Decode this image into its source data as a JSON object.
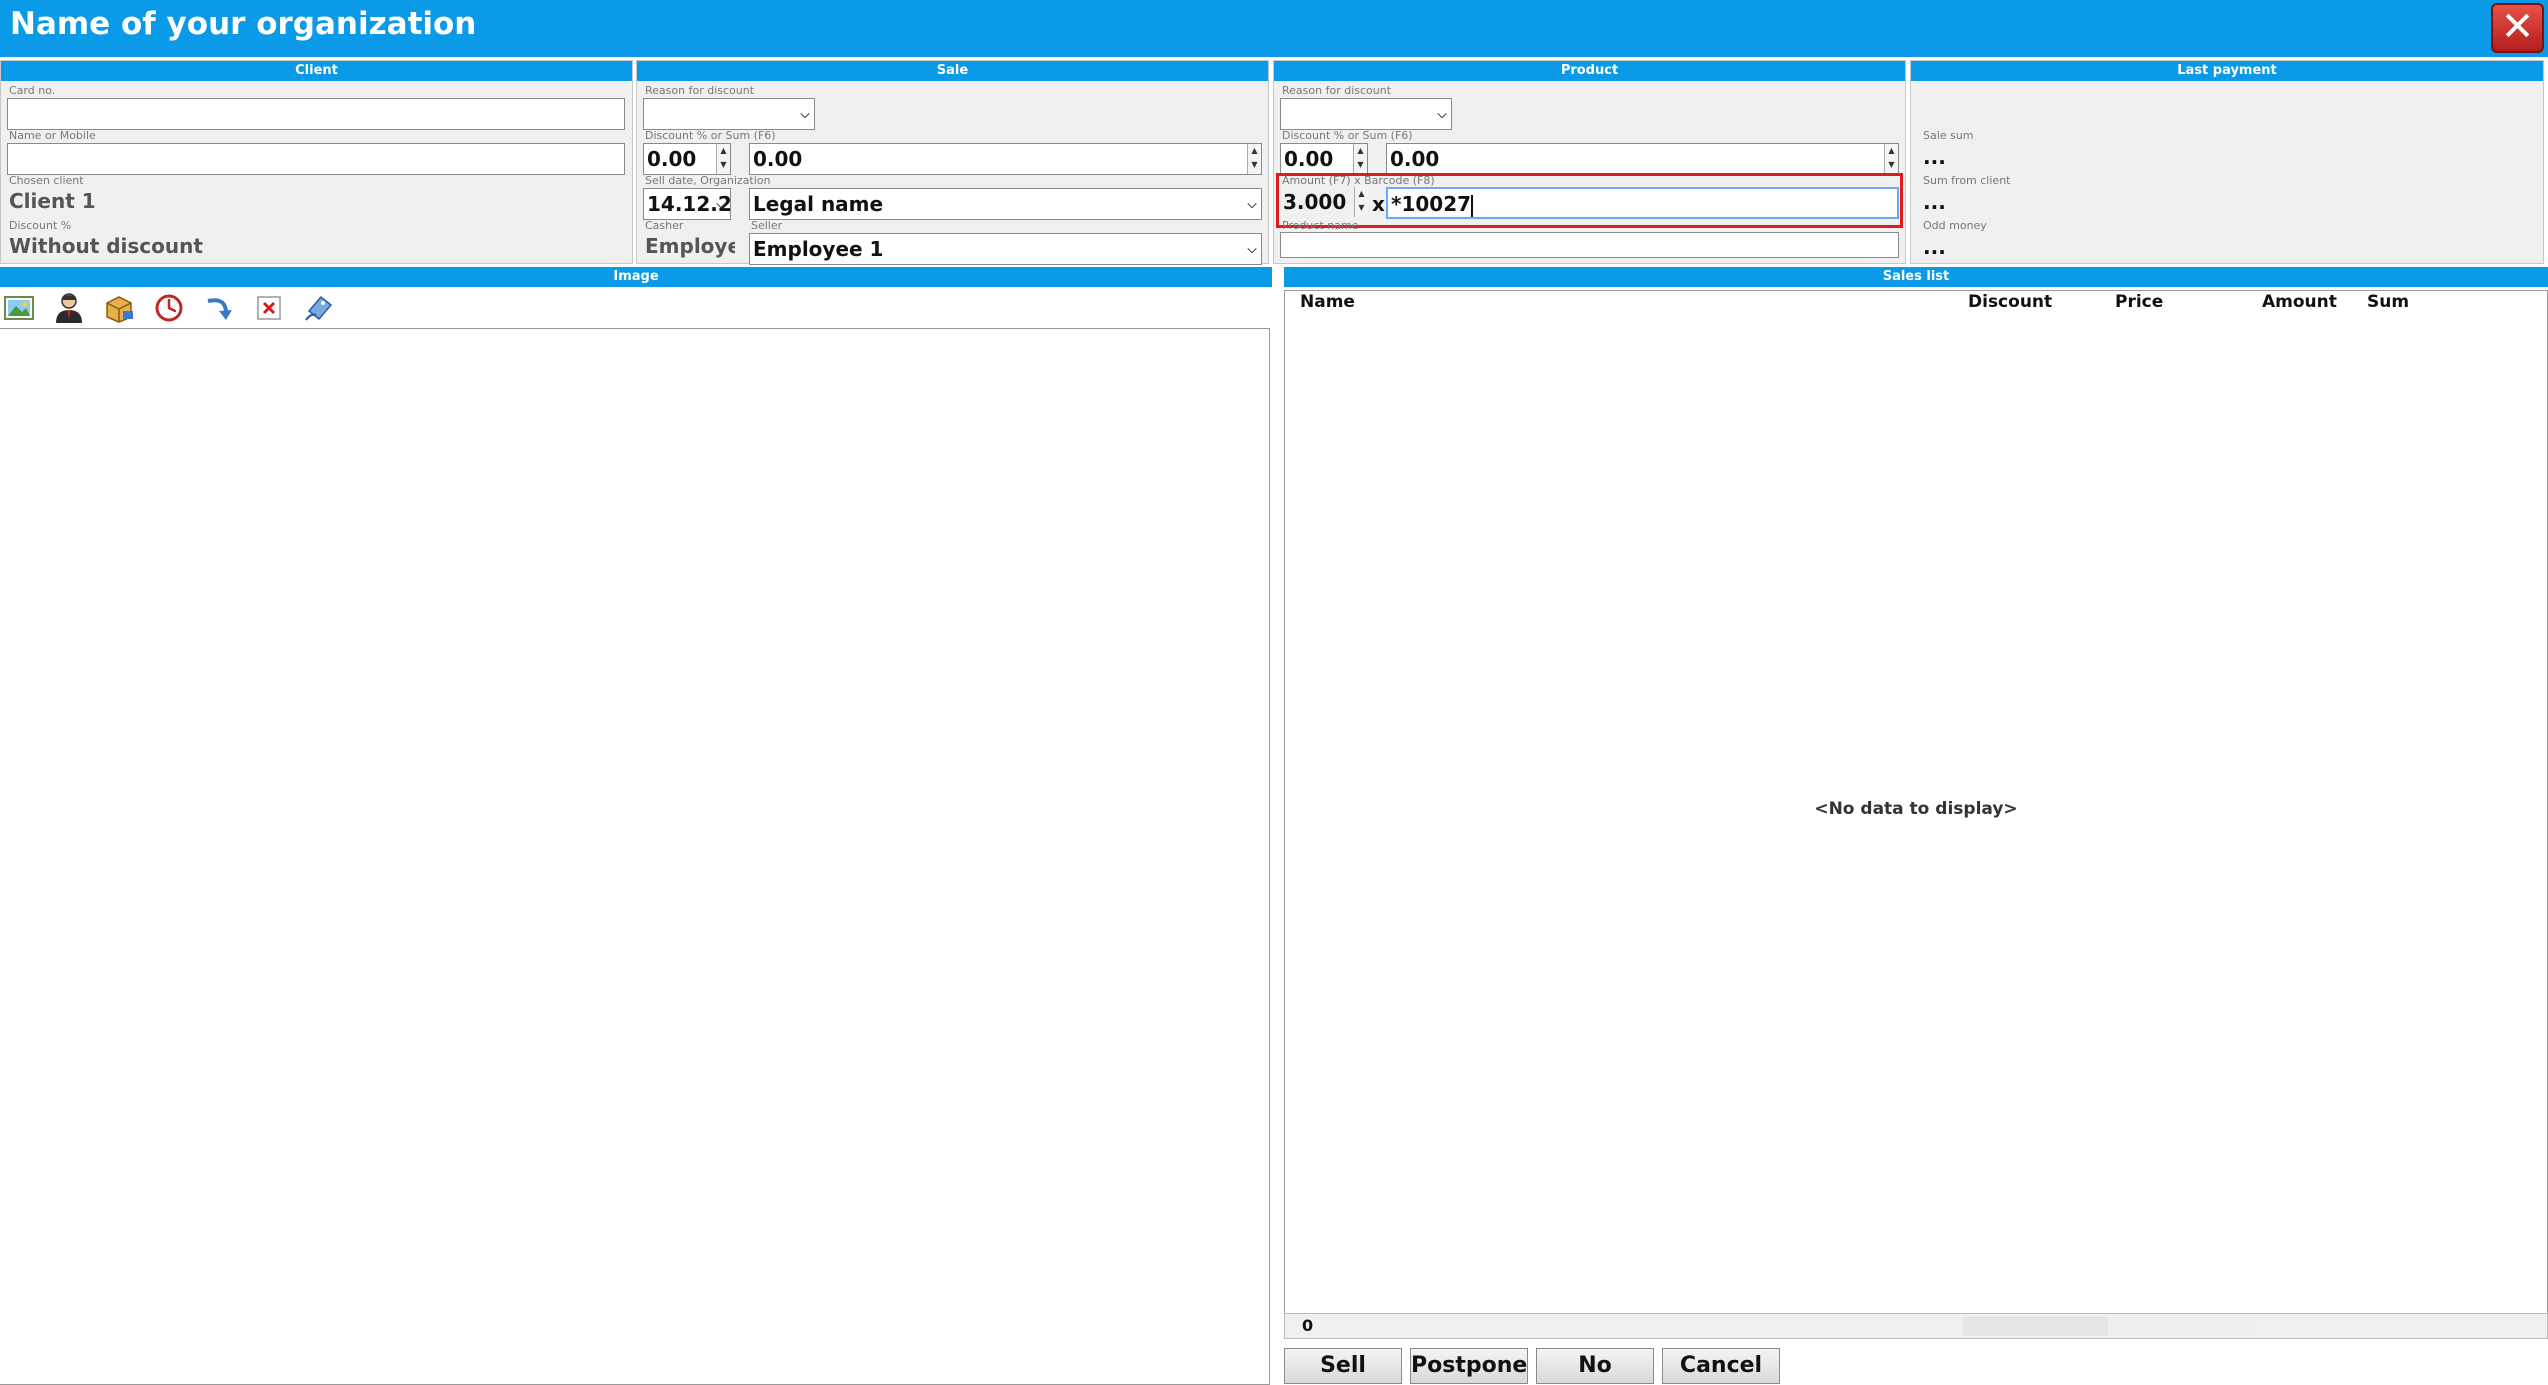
{
  "window": {
    "title": "Name of your organization",
    "close_icon": "close-icon"
  },
  "client": {
    "header": "Client",
    "card_label": "Card no.",
    "card_value": "",
    "name_label": "Name or Mobile",
    "name_value": "",
    "chosen_label": "Chosen client",
    "chosen_value": "Client 1",
    "discount_label": "Discount %",
    "discount_value": "Without discount"
  },
  "sale": {
    "header": "Sale",
    "reason_label": "Reason for discount",
    "reason_value": "",
    "discount_label": "Discount % or Sum (F6)",
    "discount_percent": "0.00",
    "discount_sum": "0.00",
    "date_org_label": "Sell date, Organization",
    "date_value": "14.12.2",
    "org_value": "Legal name",
    "cashier_label": "Casher",
    "cashier_value": "Employe",
    "seller_label": "Seller",
    "seller_value": "Employee 1"
  },
  "product": {
    "header": "Product",
    "reason_label": "Reason for discount",
    "reason_value": "",
    "discount_label": "Discount % or Sum (F6)",
    "discount_percent": "0.00",
    "discount_sum": "0.00",
    "amount_barcode_label": "Amount (F7) x Barcode (F8)",
    "amount_value": "3.000",
    "times": "x",
    "barcode_value": "*10027",
    "name_label": "Product name",
    "name_value": ""
  },
  "last_payment": {
    "header": "Last payment",
    "sale_sum_label": "Sale sum",
    "sale_sum_value": "...",
    "sum_from_client_label": "Sum from client",
    "sum_from_client_value": "...",
    "odd_money_label": "Odd money",
    "odd_money_value": "..."
  },
  "image_section": {
    "header": "Image",
    "toolbar": [
      "image-icon",
      "client-icon",
      "products-icon",
      "clock-icon",
      "return-icon",
      "delete-icon",
      "discount-card-icon"
    ]
  },
  "sales_list": {
    "header": "Sales list",
    "columns": {
      "name": "Name",
      "discount": "Discount",
      "price": "Price",
      "amount": "Amount",
      "sum": "Sum"
    },
    "empty_text": "<No data to display>",
    "footer_count": "0"
  },
  "buttons": {
    "sell": "Sell",
    "postpone": "Postpone",
    "no": "No",
    "cancel": "Cancel"
  },
  "colors": {
    "accent": "#0a9ae8",
    "highlight": "#e01b1b",
    "focus": "#6aa8ff"
  }
}
